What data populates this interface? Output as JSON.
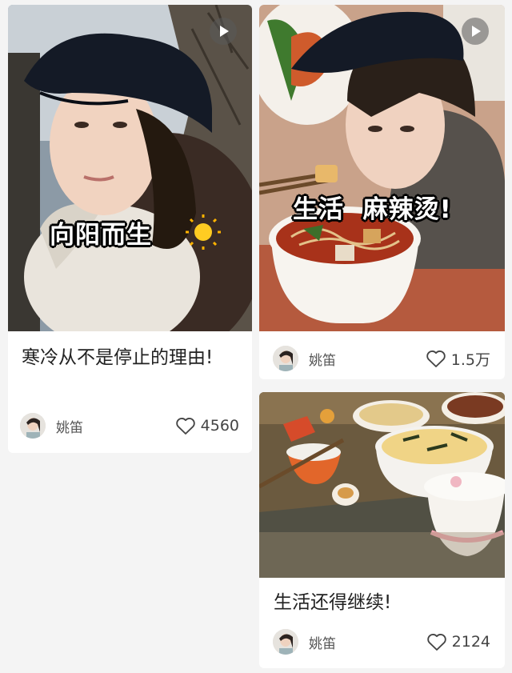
{
  "cards": [
    {
      "title": "寒冷从不是停止的理由!",
      "caption": "向阳而生",
      "author": "姚笛",
      "likes": "4560"
    },
    {
      "caption": "生活  麻辣烫!",
      "author": "姚笛",
      "likes": "1.5万"
    },
    {
      "title": "生活还得继续!",
      "author": "姚笛",
      "likes": "2124"
    }
  ]
}
